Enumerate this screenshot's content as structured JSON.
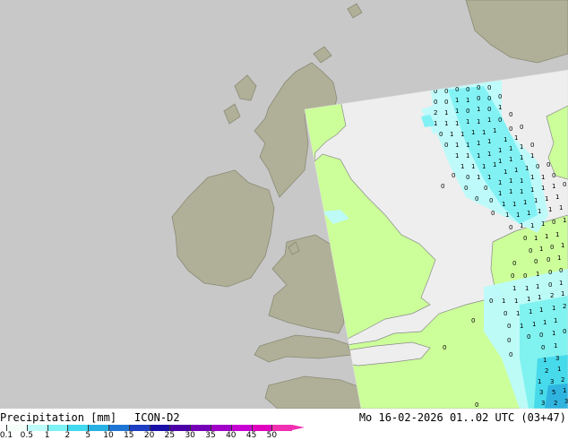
{
  "footer": {
    "title": "Precipitation [mm]",
    "model": "ICON-D2",
    "valid": "Mo 16-02-2026 01..02 UTC (03+47)"
  },
  "legend": {
    "ticks": [
      "0.1",
      "0.5",
      "1",
      "2",
      "5",
      "10",
      "15",
      "20",
      "25",
      "30",
      "35",
      "40",
      "45",
      "50"
    ],
    "colors": [
      "#f5fffa",
      "#bdfbfb",
      "#7cf2f5",
      "#3fd9f0",
      "#27b0e4",
      "#1f75d4",
      "#1d3ec2",
      "#1a10a8",
      "#4a00a6",
      "#7400b8",
      "#a000c8",
      "#c800d4",
      "#e000c0",
      "#f030b0"
    ]
  },
  "map_colors": {
    "sea": "#ffffff",
    "land_outside": "#b0b098",
    "domain_sea": "#eeeeee",
    "domain_land": "#ccff99",
    "coast_line": "#707070"
  }
}
